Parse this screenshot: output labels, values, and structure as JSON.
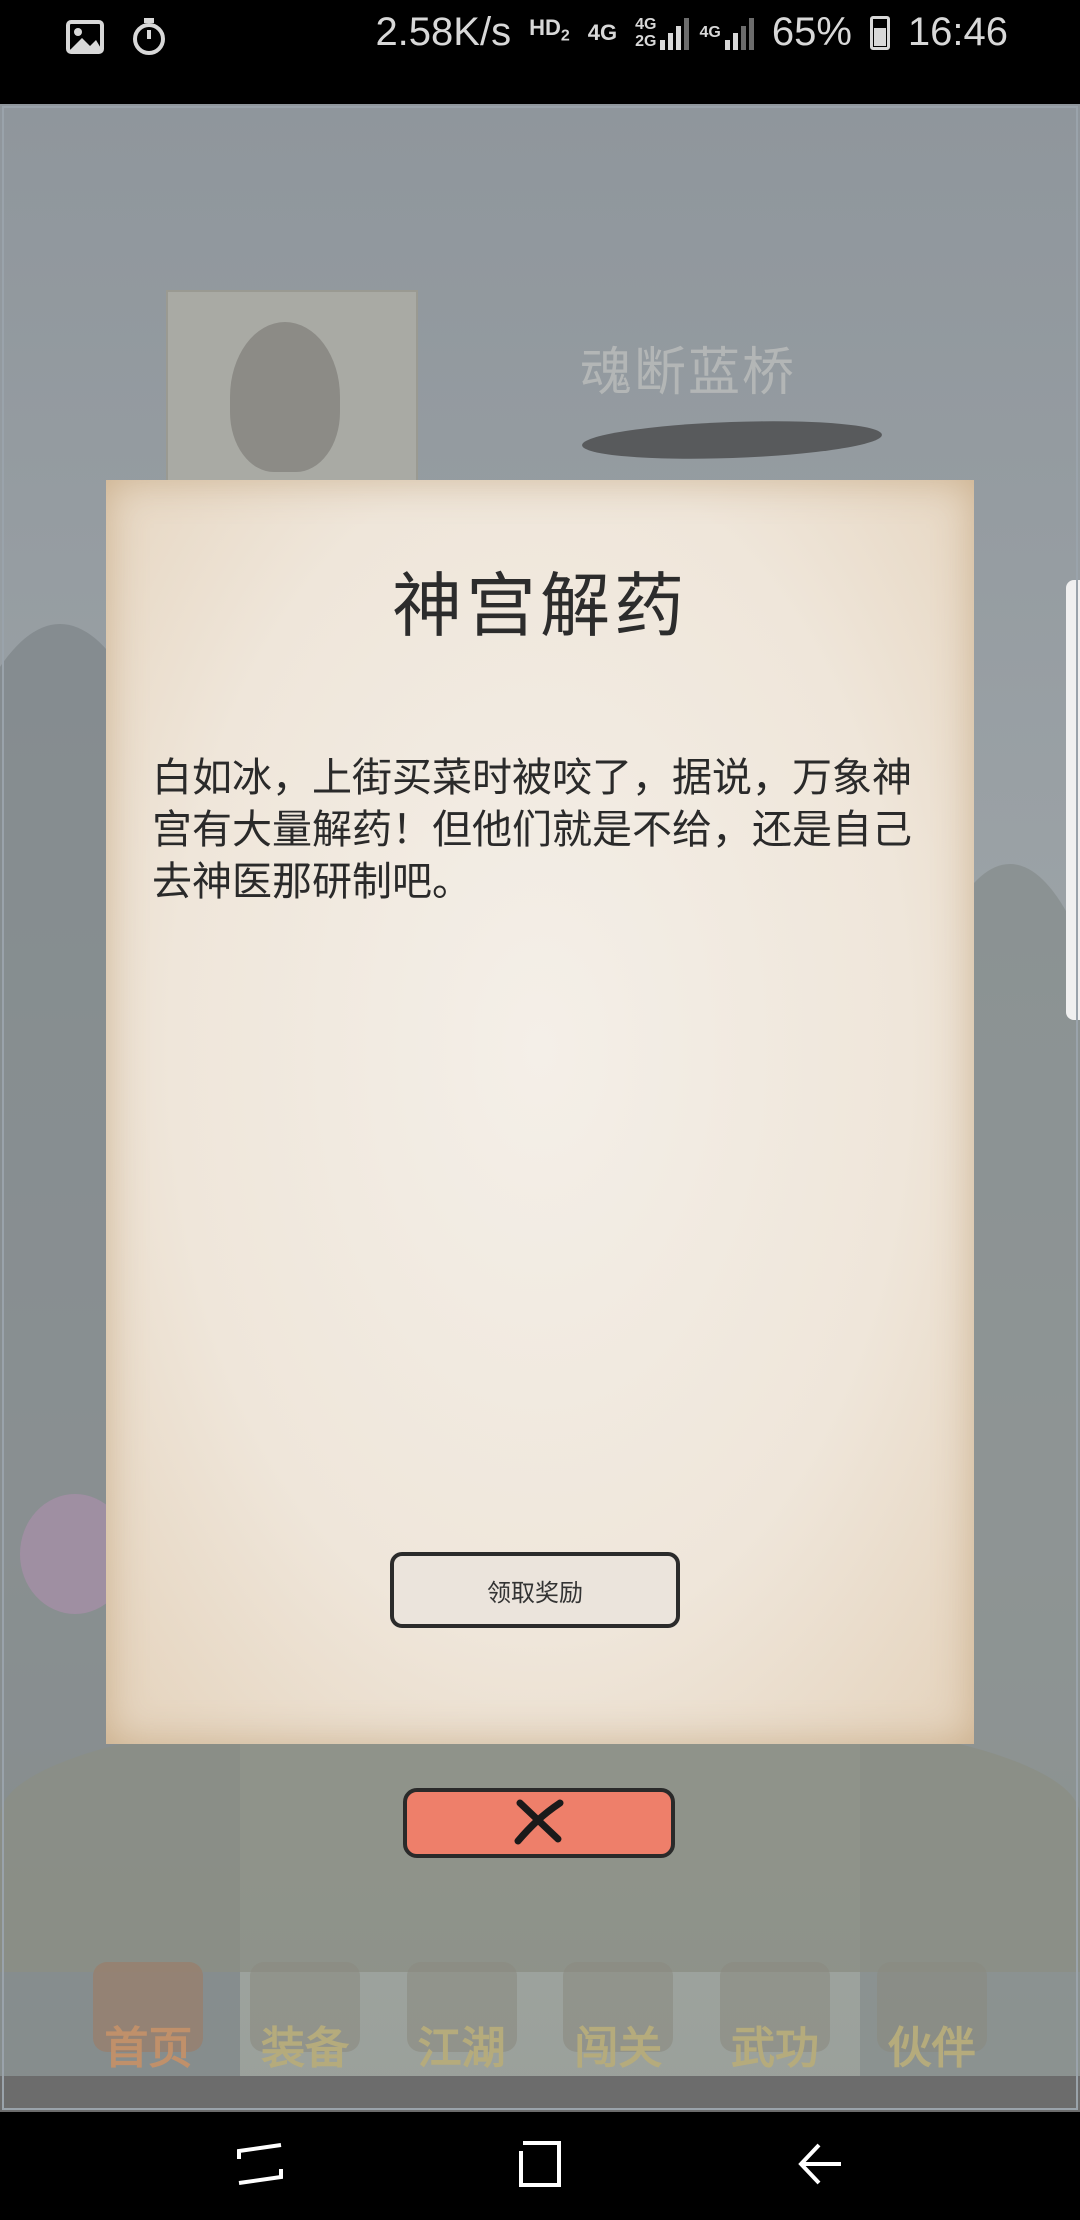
{
  "status_bar": {
    "net_speed": "2.58K/s",
    "hd_label": "HD",
    "hd_sub": "2",
    "net1": "4G",
    "net2_top": "4G",
    "net2_bottom": "2G",
    "net3": "4G",
    "battery": "65%",
    "time": "16:46",
    "icons": [
      "image-icon",
      "timer-icon",
      "signal-icon",
      "battery-icon"
    ]
  },
  "background": {
    "hero_name": "魂断蓝桥"
  },
  "dialog": {
    "title": "神宫解药",
    "body": "白如冰，上街买菜时被咬了，据说，万象神宫有大量解药！但他们就是不给，还是自己去神医那研制吧。",
    "claim_button": "领取奖励"
  },
  "close_button": {
    "icon": "close-icon"
  },
  "game_nav": {
    "items": [
      {
        "label": "首页",
        "icon": "home-icon"
      },
      {
        "label": "装备",
        "icon": "equipment-icon"
      },
      {
        "label": "江湖",
        "icon": "jianghu-icon"
      },
      {
        "label": "闯关",
        "icon": "stages-icon"
      },
      {
        "label": "武功",
        "icon": "martial-arts-icon"
      },
      {
        "label": "伙伴",
        "icon": "partners-icon"
      }
    ]
  },
  "system_nav": {
    "icons": [
      "recents-icon",
      "home-square-icon",
      "back-icon"
    ]
  },
  "colors": {
    "close_accent": "#ee7f6a",
    "parchment": "#f1e9df",
    "home_label": "#c0906a",
    "nav_label": "#b5ab7c"
  }
}
